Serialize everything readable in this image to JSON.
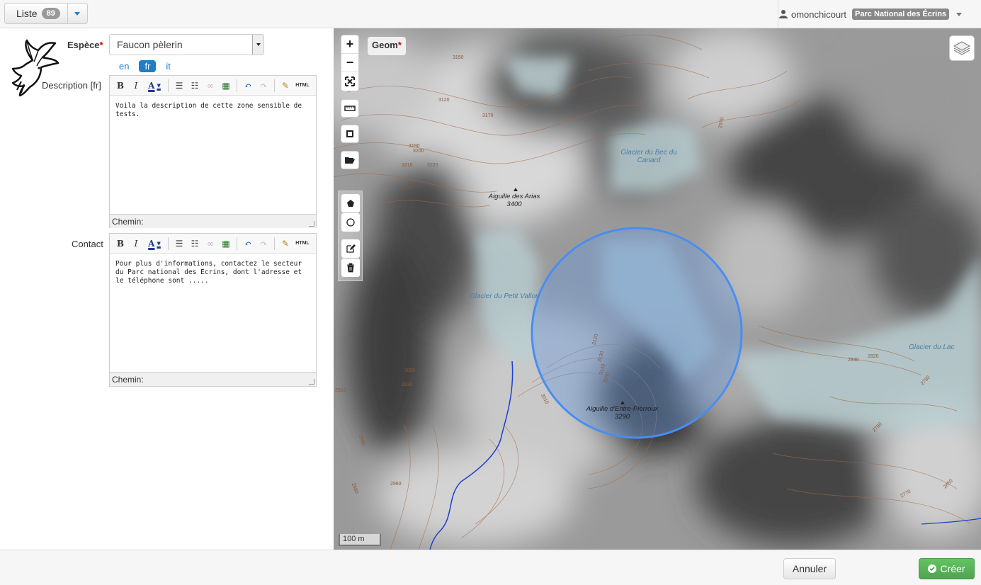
{
  "topbar": {
    "liste_label": "Liste",
    "liste_count": "89",
    "username": "omonchicourt",
    "structure": "Parc National des Écrins"
  },
  "form": {
    "espece_label": "Espèce",
    "required_mark": "*",
    "espece_value": "Faucon pèlerin",
    "lang_tabs": [
      "en",
      "fr",
      "it"
    ],
    "active_lang": "fr",
    "description_label": "Description [fr]",
    "description_text": "Voila la description de cette zone sensible de tests.",
    "contact_label": "Contact",
    "contact_text": "Pour plus d'informations, contactez le secteur du Parc national des Ecrins, dont l'adresse et le téléphone sont .....",
    "path_label": "Chemin:",
    "toolbar_html_label": "HTML"
  },
  "map": {
    "geom_label": "Geom",
    "zoom_in": "+",
    "zoom_out": "−",
    "scale_label": "100 m",
    "features": {
      "peak1_name": "Aiguille des Arias",
      "peak1_alt": "3400",
      "peak2_name": "Aiguille d'Entre-Pierroux",
      "peak2_alt": "3290",
      "glacier1": "Glacier du Bec du",
      "glacier1b": "Canard",
      "glacier2": "Glacier du Petit Vallon",
      "glacier3": "Glacier du Lac",
      "contours": [
        "3150",
        "3120",
        "3170",
        "3190",
        "3200",
        "3210",
        "3220",
        "3250",
        "3120",
        "3130",
        "3140",
        "3150",
        "2840",
        "2820",
        "2780",
        "2890",
        "2880",
        "3000",
        "3010",
        "2910",
        "2960",
        "2970",
        "2930",
        "2850",
        "2770",
        "2790"
      ]
    },
    "circle_color": "#4a8df0"
  },
  "footer": {
    "annuler_label": "Annuler",
    "creer_label": "Créer"
  },
  "colors": {
    "accent": "#1e7ec8",
    "success": "#51a351"
  }
}
